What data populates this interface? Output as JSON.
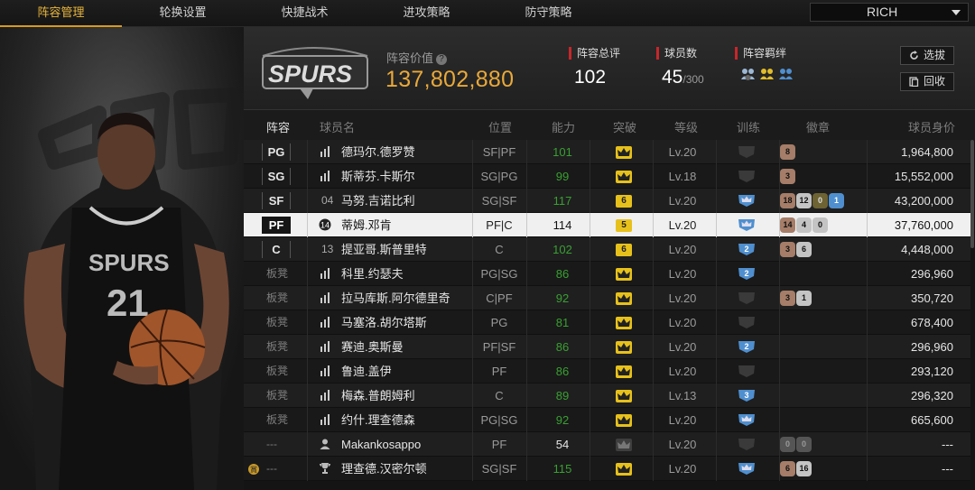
{
  "nav": {
    "tabs": [
      "阵容管理",
      "轮换设置",
      "快捷战术",
      "进攻策略",
      "防守策略"
    ],
    "active_tab": 0,
    "team_select": "RICH"
  },
  "header": {
    "value_label": "阵容价值",
    "value": "137,802,880",
    "rating_label": "阵容总评",
    "rating": "102",
    "players_label": "球员数",
    "players": "45",
    "players_max": "/300",
    "bond_label": "阵容羁绊",
    "pick_button": "选拔",
    "recycle_button": "回收"
  },
  "columns": [
    "阵容",
    "球员名",
    "位置",
    "能力",
    "突破",
    "等级",
    "训练",
    "徽章",
    "球员身价"
  ],
  "colors": {
    "accent": "#e9a93a",
    "tab_active": "#e8b53a",
    "ability_green": "#39a032",
    "break_gold": "#e7c11b",
    "stat_red": "#c8262a",
    "diamond": "#4f8fcf"
  },
  "rows": [
    {
      "slot": "PG",
      "slot_type": "starter",
      "jersey": "",
      "jersey_icon": "bars",
      "name": "德玛尔.德罗赞",
      "pos": "SF|PF",
      "ability": "101",
      "ability_color": "green",
      "break": "",
      "level": "Lv.20",
      "train": "",
      "train_type": "none",
      "badges": [
        {
          "v": "8",
          "t": "b"
        }
      ],
      "worth": "1,964,800"
    },
    {
      "slot": "SG",
      "slot_type": "starter",
      "jersey": "",
      "jersey_icon": "bars",
      "name": "斯蒂芬.卡斯尔",
      "pos": "SG|PG",
      "ability": "99",
      "ability_color": "green",
      "break": "",
      "level": "Lv.18",
      "train": "",
      "train_type": "none",
      "badges": [
        {
          "v": "3",
          "t": "b"
        }
      ],
      "worth": "15,552,000"
    },
    {
      "slot": "SF",
      "slot_type": "starter",
      "jersey": "04",
      "jersey_icon": "",
      "name": "马努.吉诺比利",
      "pos": "SG|SF",
      "ability": "117",
      "ability_color": "green",
      "break": "6",
      "level": "Lv.20",
      "train": "",
      "train_type": "crown",
      "badges": [
        {
          "v": "18",
          "t": "b"
        },
        {
          "v": "12",
          "t": "s"
        },
        {
          "v": "0",
          "t": "g"
        },
        {
          "v": "1",
          "t": "d"
        }
      ],
      "worth": "43,200,000"
    },
    {
      "slot": "PF",
      "slot_type": "selected",
      "jersey": "",
      "jersey_icon": "legend",
      "name": "蒂姆.邓肯",
      "pos": "PF|C",
      "ability": "114",
      "ability_color": "plain",
      "break": "5",
      "level": "Lv.20",
      "train": "",
      "train_type": "crown",
      "badges": [
        {
          "v": "14",
          "t": "b"
        },
        {
          "v": "4",
          "t": "s"
        },
        {
          "v": "0",
          "t": "s"
        }
      ],
      "worth": "37,760,000"
    },
    {
      "slot": "C",
      "slot_type": "starter",
      "jersey": "13",
      "jersey_icon": "",
      "name": "提亚哥.斯普里特",
      "pos": "C",
      "ability": "102",
      "ability_color": "green",
      "break": "6",
      "level": "Lv.20",
      "train": "2",
      "train_type": "num",
      "badges": [
        {
          "v": "3",
          "t": "b"
        },
        {
          "v": "6",
          "t": "s"
        }
      ],
      "worth": "4,448,000"
    },
    {
      "slot": "板凳",
      "slot_type": "bench",
      "jersey": "",
      "jersey_icon": "bars",
      "name": "科里.约瑟夫",
      "pos": "PG|SG",
      "ability": "86",
      "ability_color": "green",
      "break": "",
      "level": "Lv.20",
      "train": "2",
      "train_type": "num",
      "badges": [],
      "worth": "296,960"
    },
    {
      "slot": "板凳",
      "slot_type": "bench",
      "jersey": "",
      "jersey_icon": "bars",
      "name": "拉马库斯.阿尔德里奇",
      "pos": "C|PF",
      "ability": "92",
      "ability_color": "green",
      "break": "",
      "level": "Lv.20",
      "train": "",
      "train_type": "none",
      "badges": [
        {
          "v": "3",
          "t": "b"
        },
        {
          "v": "1",
          "t": "s"
        }
      ],
      "worth": "350,720"
    },
    {
      "slot": "板凳",
      "slot_type": "bench",
      "jersey": "",
      "jersey_icon": "bars",
      "name": "马塞洛.胡尔塔斯",
      "pos": "PG",
      "ability": "81",
      "ability_color": "green",
      "break": "",
      "level": "Lv.20",
      "train": "",
      "train_type": "none",
      "badges": [],
      "worth": "678,400"
    },
    {
      "slot": "板凳",
      "slot_type": "bench",
      "jersey": "",
      "jersey_icon": "bars",
      "name": "赛迪.奥斯曼",
      "pos": "PF|SF",
      "ability": "86",
      "ability_color": "green",
      "break": "",
      "level": "Lv.20",
      "train": "2",
      "train_type": "num",
      "badges": [],
      "worth": "296,960"
    },
    {
      "slot": "板凳",
      "slot_type": "bench",
      "jersey": "",
      "jersey_icon": "bars",
      "name": "鲁迪.盖伊",
      "pos": "PF",
      "ability": "86",
      "ability_color": "green",
      "break": "",
      "level": "Lv.20",
      "train": "",
      "train_type": "none",
      "badges": [],
      "worth": "293,120"
    },
    {
      "slot": "板凳",
      "slot_type": "bench",
      "jersey": "",
      "jersey_icon": "bars",
      "name": "梅森.普朗姆利",
      "pos": "C",
      "ability": "89",
      "ability_color": "green",
      "break": "",
      "level": "Lv.13",
      "train": "3",
      "train_type": "num",
      "badges": [],
      "worth": "296,320"
    },
    {
      "slot": "板凳",
      "slot_type": "bench",
      "jersey": "",
      "jersey_icon": "bars",
      "name": "约什.理查德森",
      "pos": "PG|SG",
      "ability": "92",
      "ability_color": "green",
      "break": "",
      "level": "Lv.20",
      "train": "",
      "train_type": "crown",
      "badges": [],
      "worth": "665,600"
    },
    {
      "slot": "---",
      "slot_type": "none",
      "jersey": "",
      "jersey_icon": "person",
      "name": "Makankosappo",
      "pos": "PF",
      "ability": "54",
      "ability_color": "plain",
      "break": "",
      "break_dim": true,
      "level": "Lv.20",
      "train": "",
      "train_type": "none",
      "badges": [
        {
          "v": "0",
          "t": "z"
        },
        {
          "v": "0",
          "t": "z"
        }
      ],
      "worth": "---"
    },
    {
      "slot": "---",
      "slot_type": "none",
      "jersey": "",
      "jersey_icon": "trophy",
      "name": "理查德.汉密尔顿",
      "pos": "SG|SF",
      "ability": "115",
      "ability_color": "green",
      "break": "",
      "level": "Lv.20",
      "train": "",
      "train_type": "crown",
      "badges": [
        {
          "v": "6",
          "t": "b"
        },
        {
          "v": "16",
          "t": "s"
        }
      ],
      "worth": "---"
    }
  ]
}
